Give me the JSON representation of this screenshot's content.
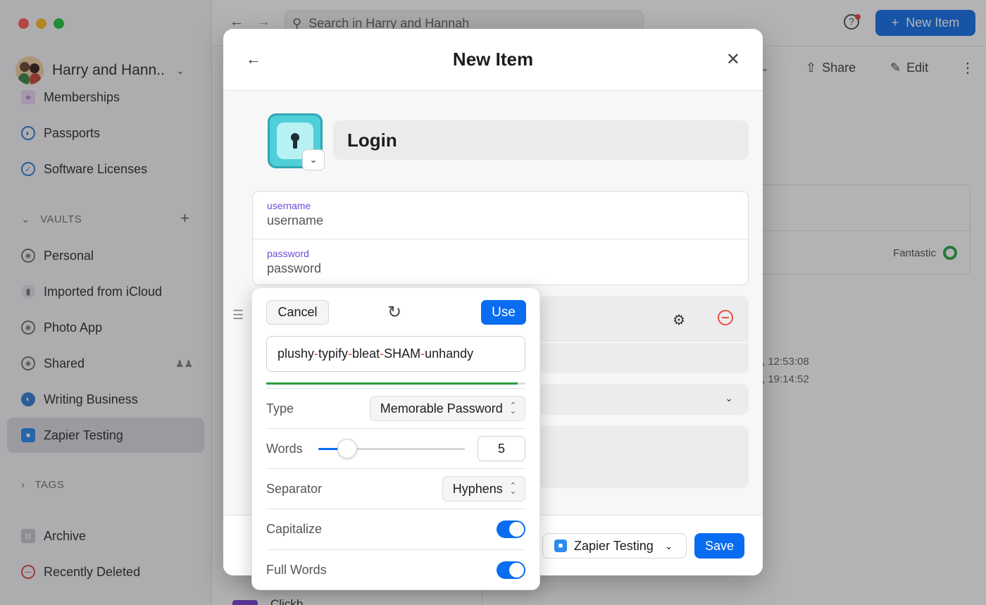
{
  "app": {
    "account_name": "Harry and Hann...",
    "search_placeholder": "Search in Harry and Hannah",
    "new_item_label": "New Item",
    "share_label": "Share",
    "edit_label": "Edit"
  },
  "sidebar": {
    "categories": [
      {
        "label": "Memberships",
        "icon": "membership-icon",
        "color": "#b57cc9"
      },
      {
        "label": "Passports",
        "icon": "globe-icon",
        "color": "#3b7fd6"
      },
      {
        "label": "Software Licenses",
        "icon": "badge-icon",
        "color": "#3b7fd6"
      }
    ],
    "vaults_header": "VAULTS",
    "vaults": [
      {
        "label": "Personal",
        "icon": "vault-icon"
      },
      {
        "label": "Imported from iCloud",
        "icon": "vault-icon"
      },
      {
        "label": "Photo App",
        "icon": "vault-icon"
      },
      {
        "label": "Shared",
        "icon": "vault-icon"
      },
      {
        "label": "Writing Business",
        "icon": "globe-icon"
      },
      {
        "label": "Zapier Testing",
        "icon": "robot-icon"
      }
    ],
    "tags_header": "TAGS",
    "footer": [
      {
        "label": "Archive",
        "icon": "archive-icon"
      },
      {
        "label": "Recently Deleted",
        "icon": "trash-icon"
      }
    ]
  },
  "background_detail": {
    "strength_label": "Fantastic",
    "timestamp_1": ", 12:53:08",
    "timestamp_2": ", 19:14:52",
    "list_stub": "Clickb..."
  },
  "modal": {
    "title": "New Item",
    "item_title": "Login",
    "fields": [
      {
        "label": "username",
        "placeholder": "username"
      },
      {
        "label": "password",
        "placeholder": "password"
      }
    ],
    "vault_label": "Zapier Testing",
    "save_label": "Save"
  },
  "generator": {
    "cancel_label": "Cancel",
    "use_label": "Use",
    "password_parts": [
      "plushy",
      "typify",
      "bleat",
      "SHAM",
      "unhandy"
    ],
    "separator_char": "-",
    "strength_fraction": 0.97,
    "type_label": "Type",
    "type_value": "Memorable Password",
    "words_label": "Words",
    "words_value": "5",
    "words_slider_fraction": 0.2,
    "separator_label": "Separator",
    "separator_value": "Hyphens",
    "capitalize_label": "Capitalize",
    "capitalize_on": true,
    "full_words_label": "Full Words",
    "full_words_on": true
  },
  "colors": {
    "accent": "#0a6cf0",
    "field_label": "#6e4bd8",
    "separator_red": "#e0443a",
    "strength_green": "#2e9c3a"
  }
}
